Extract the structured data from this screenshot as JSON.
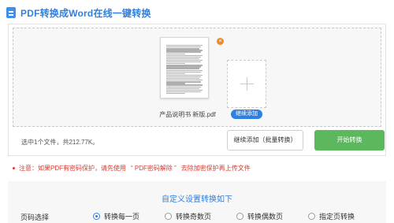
{
  "header": {
    "title": "PDF转换成Word在线一键转换",
    "icon": "document-icon"
  },
  "upload": {
    "file": {
      "name": "产品说明书 新版.pdf",
      "remove_glyph": "×"
    },
    "add_more_label": "继续添加",
    "summary": "选中1个文件，共212.77K。",
    "continue_button": "继续添加（批量转换）",
    "start_button": "开始转换"
  },
  "notice": {
    "prefix": "注意：如果PDF有密码保护，请先使用",
    "link": "“ PDF密码解除 ”",
    "suffix": "去除加密保护再上传文件"
  },
  "settings": {
    "title": "自定义设置转换如下",
    "page_select_label": "页码选择",
    "options": [
      {
        "label": "转换每一页",
        "checked": true
      },
      {
        "label": "转换奇数页",
        "checked": false
      },
      {
        "label": "转换偶数页",
        "checked": false
      },
      {
        "label": "指定页转换",
        "checked": false
      }
    ]
  },
  "colors": {
    "accent": "#2f7fe0",
    "start_button": "#5cb85c",
    "warning": "#e3352c",
    "remove_badge": "#f08a24"
  }
}
